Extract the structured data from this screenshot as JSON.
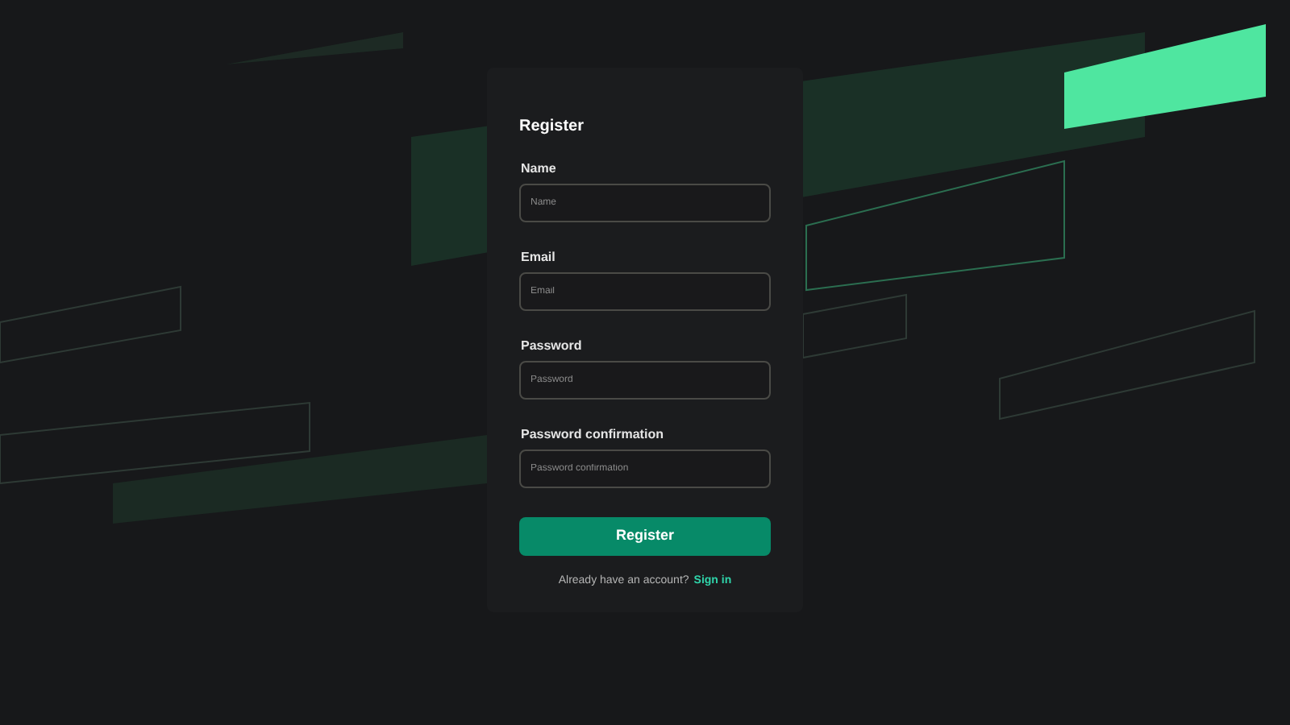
{
  "form": {
    "title": "Register",
    "fields": [
      {
        "label": "Name",
        "placeholder": "Name"
      },
      {
        "label": "Email",
        "placeholder": "Email"
      },
      {
        "label": "Password",
        "placeholder": "Password"
      },
      {
        "label": "Password confirmation",
        "placeholder": "Password confirmation"
      }
    ],
    "submit": "Register",
    "footer": {
      "text": "Already have an account?",
      "link": "Sign in"
    }
  }
}
